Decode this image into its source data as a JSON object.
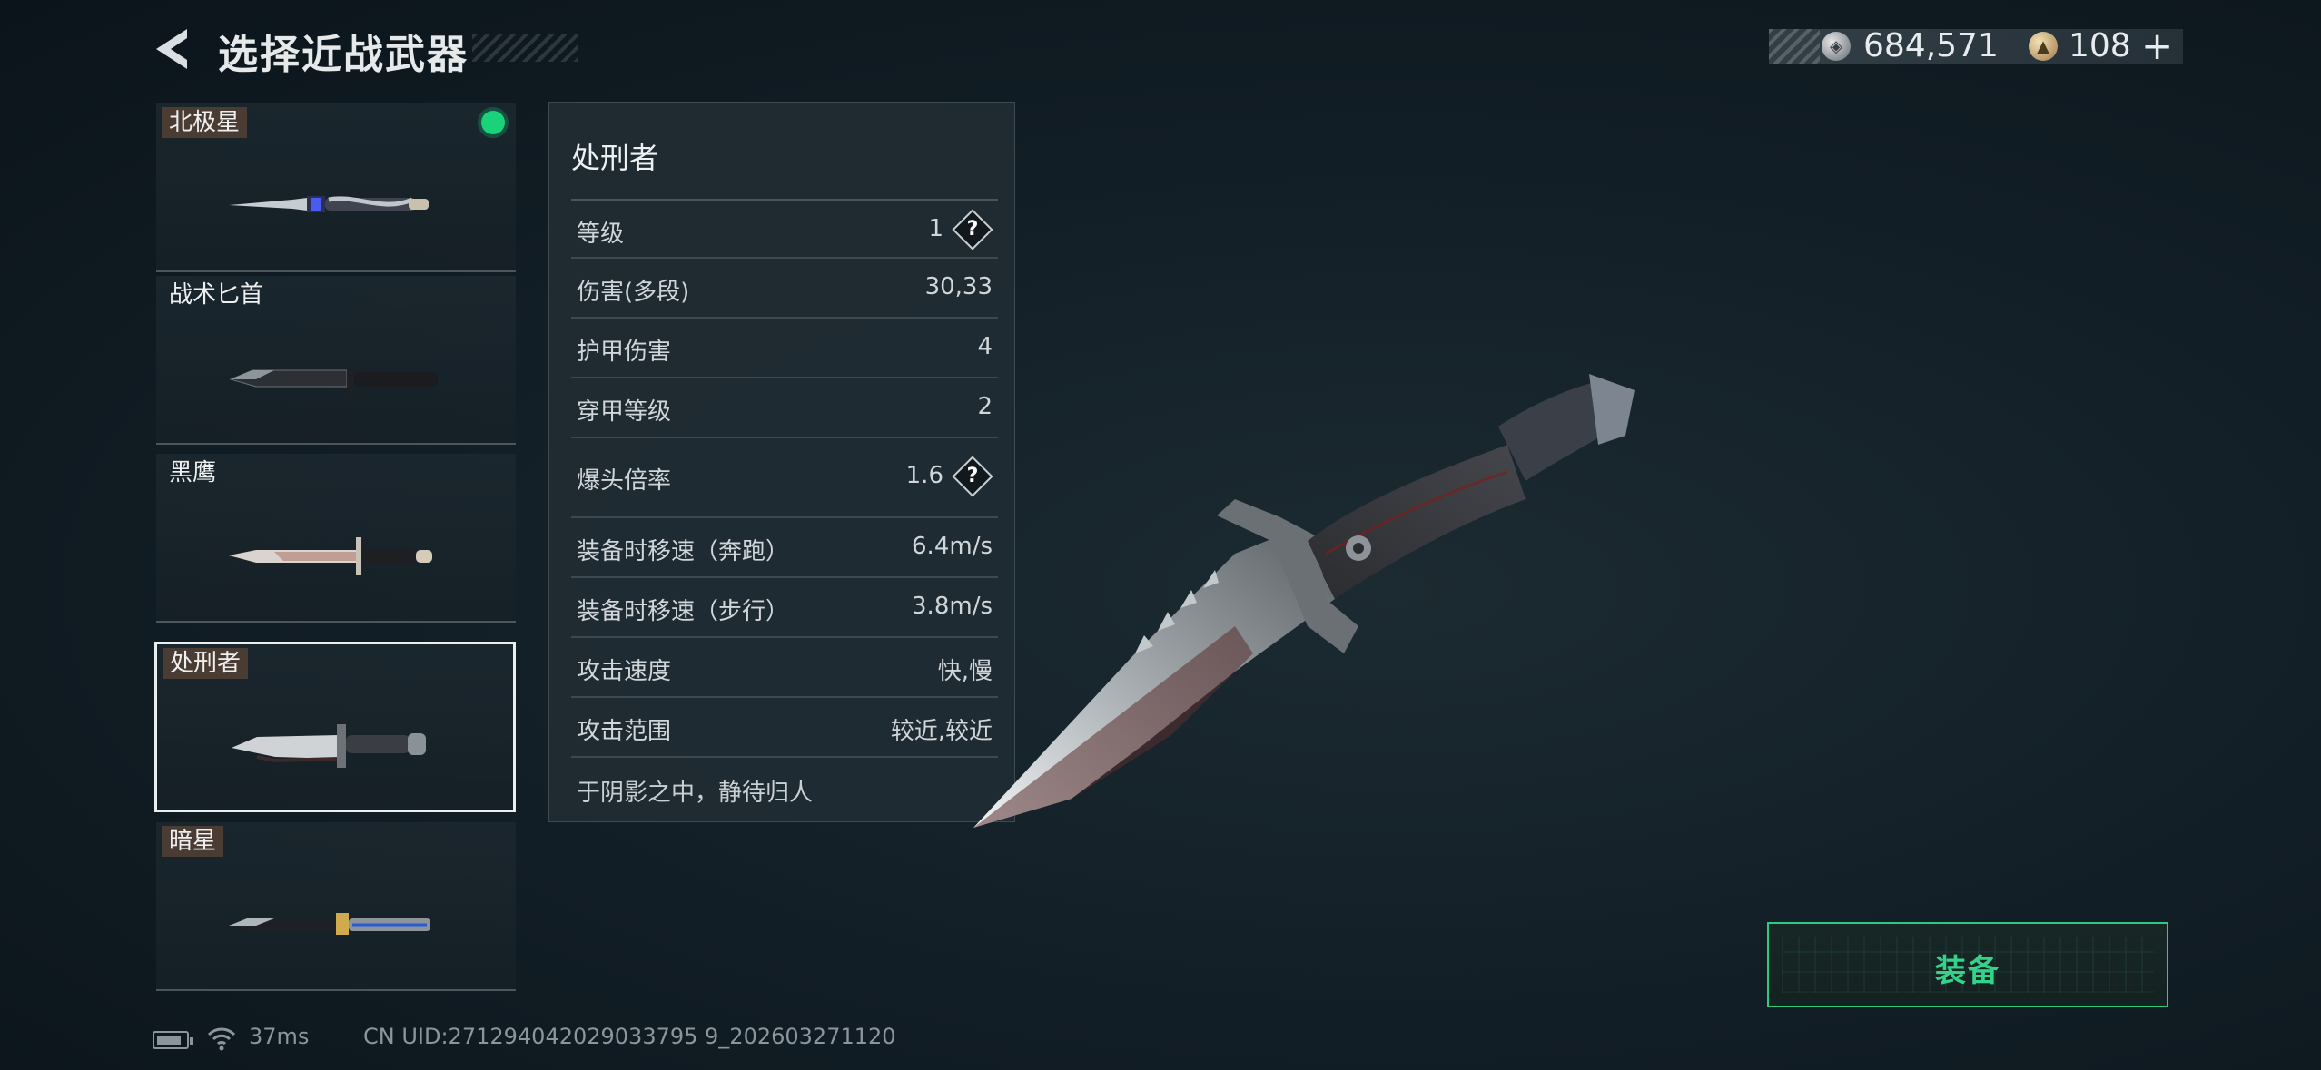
{
  "header": {
    "title": "选择近战武器",
    "currency": {
      "silver_amount": "684,571",
      "gold_amount": "108",
      "add_label": "+"
    }
  },
  "weapon_list": [
    {
      "name": "北极星",
      "tagged": true,
      "equipped": true,
      "selected": false,
      "icon": "polaris-knife-icon"
    },
    {
      "name": "战术匕首",
      "tagged": false,
      "equipped": false,
      "selected": false,
      "icon": "tactical-dagger-icon"
    },
    {
      "name": "黑鹰",
      "tagged": false,
      "equipped": false,
      "selected": false,
      "icon": "black-hawk-knife-icon"
    },
    {
      "name": "处刑者",
      "tagged": true,
      "equipped": false,
      "selected": true,
      "icon": "executioner-knife-icon"
    },
    {
      "name": "暗星",
      "tagged": true,
      "equipped": false,
      "selected": false,
      "icon": "dark-star-knife-icon"
    }
  ],
  "details": {
    "name": "处刑者",
    "stats": [
      {
        "label": "等级",
        "value": "1",
        "help": true
      },
      {
        "label": "伤害(多段)",
        "value": "30,33",
        "help": false
      },
      {
        "label": "护甲伤害",
        "value": "4",
        "help": false
      },
      {
        "label": "穿甲等级",
        "value": "2",
        "help": false
      },
      {
        "label": "爆头倍率",
        "value": "1.6",
        "help": true
      },
      {
        "label": "装备时移速（奔跑）",
        "value": "6.4m/s",
        "help": false
      },
      {
        "label": "装备时移速（步行）",
        "value": "3.8m/s",
        "help": false
      },
      {
        "label": "攻击速度",
        "value": "快,慢",
        "help": false
      },
      {
        "label": "攻击范围",
        "value": "较近,较近",
        "help": false
      }
    ],
    "help_label": "?",
    "description": "于阴影之中，静待归人"
  },
  "equip_button": {
    "label": "装备"
  },
  "status_bar": {
    "ping": "37ms",
    "uid": "CN UID:271294042029033795 9_202603271120"
  },
  "colors": {
    "accent_green": "#2fca7e",
    "equipped_dot": "#19d27a",
    "tag_bg": "#4a3c33",
    "panel_bg": "#202c33"
  }
}
